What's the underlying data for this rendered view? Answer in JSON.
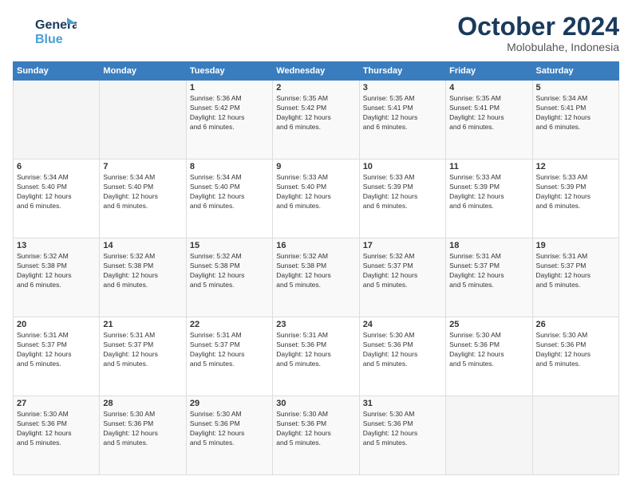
{
  "logo": {
    "line1": "General",
    "line2": "Blue"
  },
  "title": "October 2024",
  "subtitle": "Molobulahe, Indonesia",
  "days": [
    "Sunday",
    "Monday",
    "Tuesday",
    "Wednesday",
    "Thursday",
    "Friday",
    "Saturday"
  ],
  "weeks": [
    [
      {
        "day": "",
        "info": ""
      },
      {
        "day": "",
        "info": ""
      },
      {
        "day": "1",
        "info": "Sunrise: 5:36 AM\nSunset: 5:42 PM\nDaylight: 12 hours\nand 6 minutes."
      },
      {
        "day": "2",
        "info": "Sunrise: 5:35 AM\nSunset: 5:42 PM\nDaylight: 12 hours\nand 6 minutes."
      },
      {
        "day": "3",
        "info": "Sunrise: 5:35 AM\nSunset: 5:41 PM\nDaylight: 12 hours\nand 6 minutes."
      },
      {
        "day": "4",
        "info": "Sunrise: 5:35 AM\nSunset: 5:41 PM\nDaylight: 12 hours\nand 6 minutes."
      },
      {
        "day": "5",
        "info": "Sunrise: 5:34 AM\nSunset: 5:41 PM\nDaylight: 12 hours\nand 6 minutes."
      }
    ],
    [
      {
        "day": "6",
        "info": "Sunrise: 5:34 AM\nSunset: 5:40 PM\nDaylight: 12 hours\nand 6 minutes."
      },
      {
        "day": "7",
        "info": "Sunrise: 5:34 AM\nSunset: 5:40 PM\nDaylight: 12 hours\nand 6 minutes."
      },
      {
        "day": "8",
        "info": "Sunrise: 5:34 AM\nSunset: 5:40 PM\nDaylight: 12 hours\nand 6 minutes."
      },
      {
        "day": "9",
        "info": "Sunrise: 5:33 AM\nSunset: 5:40 PM\nDaylight: 12 hours\nand 6 minutes."
      },
      {
        "day": "10",
        "info": "Sunrise: 5:33 AM\nSunset: 5:39 PM\nDaylight: 12 hours\nand 6 minutes."
      },
      {
        "day": "11",
        "info": "Sunrise: 5:33 AM\nSunset: 5:39 PM\nDaylight: 12 hours\nand 6 minutes."
      },
      {
        "day": "12",
        "info": "Sunrise: 5:33 AM\nSunset: 5:39 PM\nDaylight: 12 hours\nand 6 minutes."
      }
    ],
    [
      {
        "day": "13",
        "info": "Sunrise: 5:32 AM\nSunset: 5:38 PM\nDaylight: 12 hours\nand 6 minutes."
      },
      {
        "day": "14",
        "info": "Sunrise: 5:32 AM\nSunset: 5:38 PM\nDaylight: 12 hours\nand 6 minutes."
      },
      {
        "day": "15",
        "info": "Sunrise: 5:32 AM\nSunset: 5:38 PM\nDaylight: 12 hours\nand 5 minutes."
      },
      {
        "day": "16",
        "info": "Sunrise: 5:32 AM\nSunset: 5:38 PM\nDaylight: 12 hours\nand 5 minutes."
      },
      {
        "day": "17",
        "info": "Sunrise: 5:32 AM\nSunset: 5:37 PM\nDaylight: 12 hours\nand 5 minutes."
      },
      {
        "day": "18",
        "info": "Sunrise: 5:31 AM\nSunset: 5:37 PM\nDaylight: 12 hours\nand 5 minutes."
      },
      {
        "day": "19",
        "info": "Sunrise: 5:31 AM\nSunset: 5:37 PM\nDaylight: 12 hours\nand 5 minutes."
      }
    ],
    [
      {
        "day": "20",
        "info": "Sunrise: 5:31 AM\nSunset: 5:37 PM\nDaylight: 12 hours\nand 5 minutes."
      },
      {
        "day": "21",
        "info": "Sunrise: 5:31 AM\nSunset: 5:37 PM\nDaylight: 12 hours\nand 5 minutes."
      },
      {
        "day": "22",
        "info": "Sunrise: 5:31 AM\nSunset: 5:37 PM\nDaylight: 12 hours\nand 5 minutes."
      },
      {
        "day": "23",
        "info": "Sunrise: 5:31 AM\nSunset: 5:36 PM\nDaylight: 12 hours\nand 5 minutes."
      },
      {
        "day": "24",
        "info": "Sunrise: 5:30 AM\nSunset: 5:36 PM\nDaylight: 12 hours\nand 5 minutes."
      },
      {
        "day": "25",
        "info": "Sunrise: 5:30 AM\nSunset: 5:36 PM\nDaylight: 12 hours\nand 5 minutes."
      },
      {
        "day": "26",
        "info": "Sunrise: 5:30 AM\nSunset: 5:36 PM\nDaylight: 12 hours\nand 5 minutes."
      }
    ],
    [
      {
        "day": "27",
        "info": "Sunrise: 5:30 AM\nSunset: 5:36 PM\nDaylight: 12 hours\nand 5 minutes."
      },
      {
        "day": "28",
        "info": "Sunrise: 5:30 AM\nSunset: 5:36 PM\nDaylight: 12 hours\nand 5 minutes."
      },
      {
        "day": "29",
        "info": "Sunrise: 5:30 AM\nSunset: 5:36 PM\nDaylight: 12 hours\nand 5 minutes."
      },
      {
        "day": "30",
        "info": "Sunrise: 5:30 AM\nSunset: 5:36 PM\nDaylight: 12 hours\nand 5 minutes."
      },
      {
        "day": "31",
        "info": "Sunrise: 5:30 AM\nSunset: 5:36 PM\nDaylight: 12 hours\nand 5 minutes."
      },
      {
        "day": "",
        "info": ""
      },
      {
        "day": "",
        "info": ""
      }
    ]
  ]
}
